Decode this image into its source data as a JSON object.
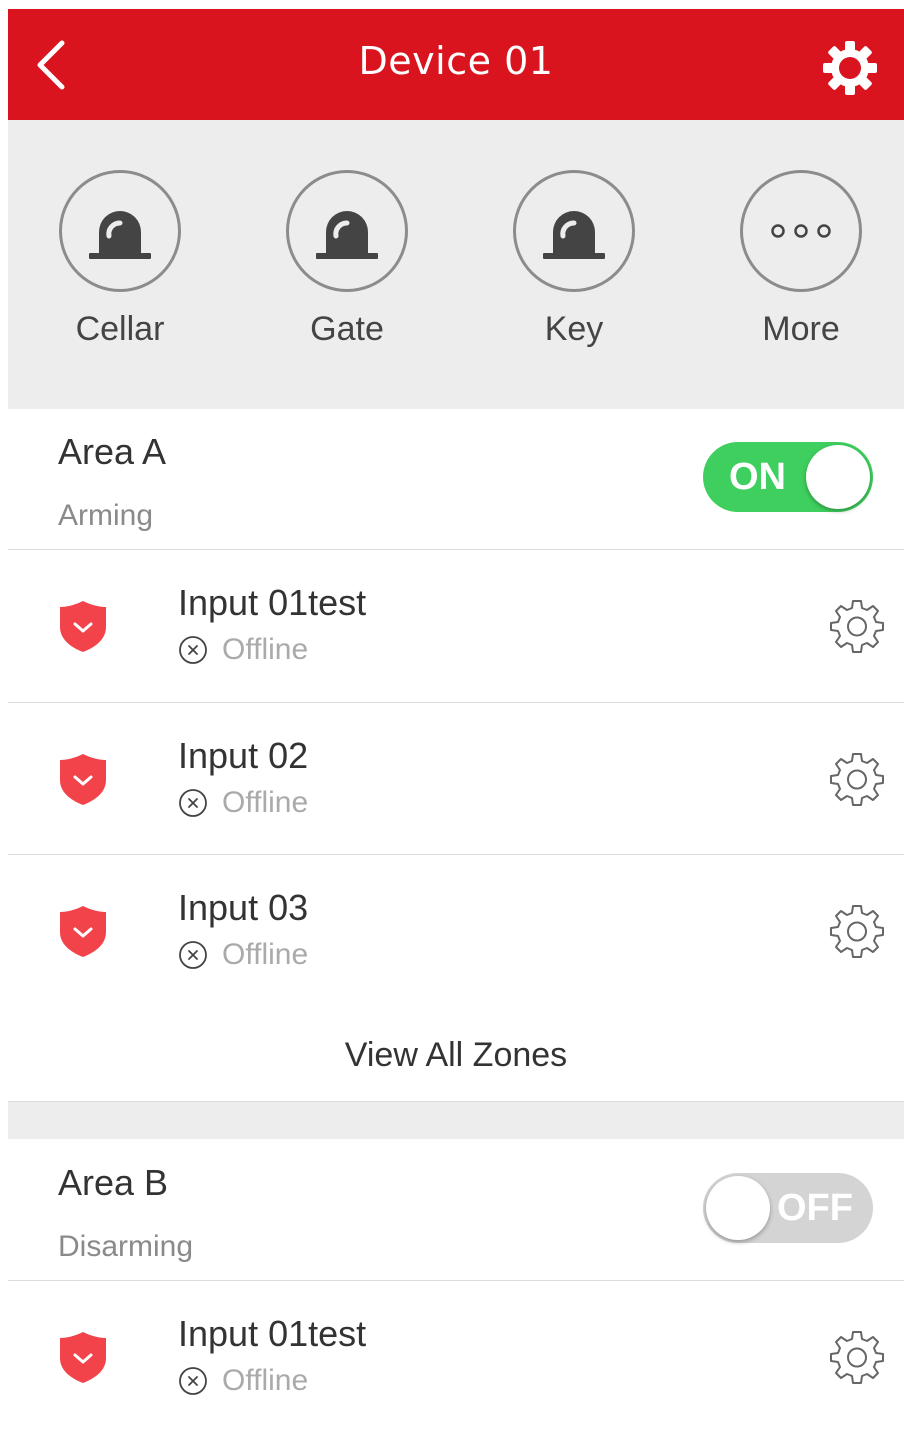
{
  "header": {
    "title": "Device 01"
  },
  "quick_actions": [
    {
      "label": "Cellar",
      "icon": "alarm-light-icon"
    },
    {
      "label": "Gate",
      "icon": "alarm-light-icon"
    },
    {
      "label": "Key",
      "icon": "alarm-light-icon"
    },
    {
      "label": "More",
      "icon": "more-dots-icon"
    }
  ],
  "areas": [
    {
      "name": "Area A",
      "status": "Arming",
      "toggle": {
        "state": "on",
        "label": "ON"
      },
      "zones": [
        {
          "name": "Input 01test",
          "status": "Offline"
        },
        {
          "name": "Input 02",
          "status": "Offline"
        },
        {
          "name": "Input 03",
          "status": "Offline"
        }
      ],
      "view_all_label": "View All Zones"
    },
    {
      "name": "Area B",
      "status": "Disarming",
      "toggle": {
        "state": "off",
        "label": "OFF"
      },
      "zones": [
        {
          "name": "Input 01test",
          "status": "Offline"
        }
      ]
    }
  ],
  "colors": {
    "header": "#d9141f",
    "toggle_on": "#3fcf5e",
    "toggle_off": "#d4d4d4",
    "shield": "#f2434b",
    "panel_bg": "#ededed"
  }
}
